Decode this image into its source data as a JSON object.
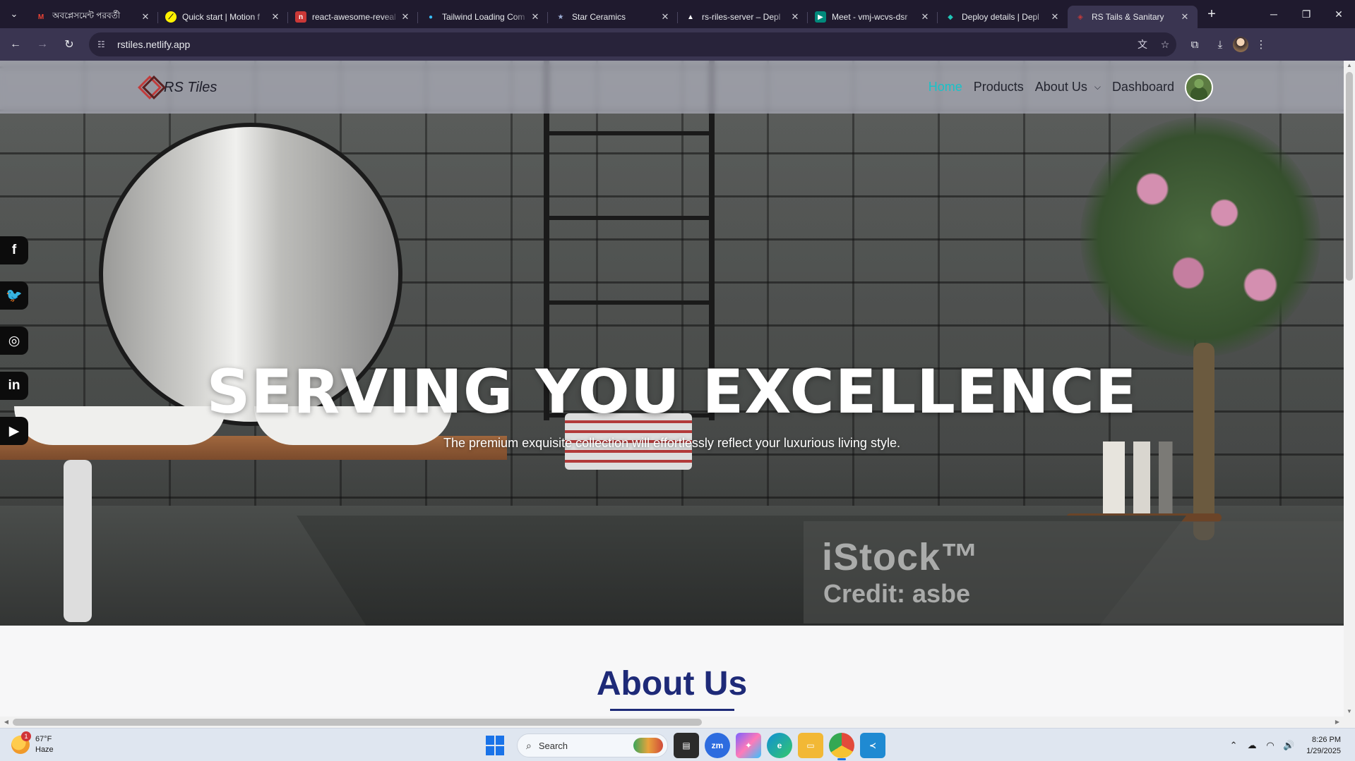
{
  "browser": {
    "tabs": [
      {
        "title": "অবপ্লেসমেন্ট পরবর্তী",
        "favicon": "gmail-icon",
        "color": "#ea4335",
        "active": false
      },
      {
        "title": "Quick start | Motion f",
        "favicon": "motion-icon",
        "color": "#fff200",
        "active": false
      },
      {
        "title": "react-awesome-reveal",
        "favicon": "npm-icon",
        "color": "#cb3837",
        "active": false
      },
      {
        "title": "Tailwind Loading Com",
        "favicon": "tailwind-icon",
        "color": "#38bdf8",
        "active": false
      },
      {
        "title": "Star Ceramics",
        "favicon": "star-icon",
        "color": "#9fb0d8",
        "active": false
      },
      {
        "title": "rs-riles-server – Depl",
        "favicon": "vercel-icon",
        "color": "#ffffff",
        "active": false
      },
      {
        "title": "Meet - vmj-wcvs-dsr",
        "favicon": "meet-icon",
        "color": "#00897b",
        "active": false
      },
      {
        "title": "Deploy details | Depl",
        "favicon": "netlify-icon",
        "color": "#20c6b7",
        "active": false
      },
      {
        "title": "RS Tails & Sanitary",
        "favicon": "rs-logo-icon",
        "color": "#c23b3b",
        "active": true
      }
    ],
    "url": "rstiles.netlify.app"
  },
  "site": {
    "brand": "RS Tiles",
    "nav": {
      "home": "Home",
      "products": "Products",
      "about": "About Us",
      "dashboard": "Dashboard"
    },
    "hero": {
      "title": "SERVING YOU EXCELLENCE",
      "subtitle": "The premium exquisite collection will effortlessly reflect your luxurious living style.",
      "watermark_brand": "iStock™",
      "watermark_credit": "Credit: asbe"
    },
    "social": [
      "facebook-icon",
      "twitter-icon",
      "instagram-icon",
      "linkedin-icon",
      "youtube-icon"
    ],
    "about_title": "About Us"
  },
  "taskbar": {
    "weather_temp": "67°F",
    "weather_desc": "Haze",
    "weather_badge": "1",
    "search_placeholder": "Search",
    "time": "8:26 PM",
    "date": "1/29/2025",
    "apps": [
      {
        "name": "task-view-icon",
        "color": "#2b2b2b"
      },
      {
        "name": "zoom-icon",
        "color": "#2d6cdf"
      },
      {
        "name": "copilot-icon",
        "color": "#7b61ff"
      },
      {
        "name": "edge-icon",
        "color": "#0f8fd6"
      },
      {
        "name": "file-explorer-icon",
        "color": "#f2b835"
      },
      {
        "name": "chrome-icon",
        "color": "#e24a3b",
        "active": true
      },
      {
        "name": "vscode-icon",
        "color": "#1f8ad2"
      }
    ]
  }
}
